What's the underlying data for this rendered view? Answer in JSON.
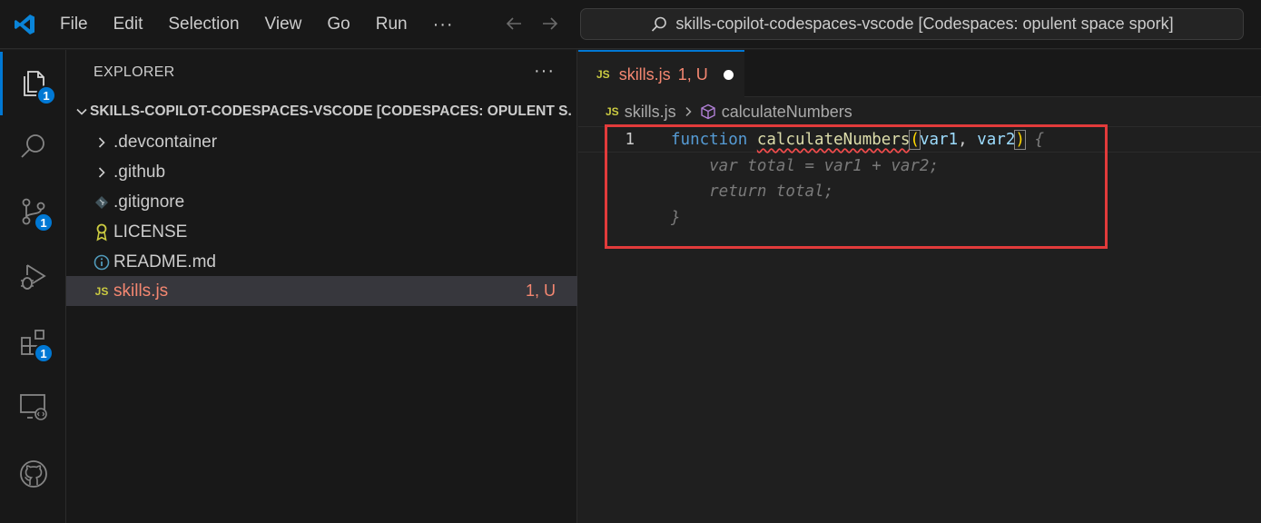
{
  "titlebar": {
    "menu": [
      "File",
      "Edit",
      "Selection",
      "View",
      "Go",
      "Run"
    ],
    "more": "···",
    "command_center": "skills-copilot-codespaces-vscode [Codespaces: opulent space spork]"
  },
  "activity_bar": {
    "items": [
      {
        "icon": "files-icon",
        "badge": "1",
        "active": true
      },
      {
        "icon": "search-icon",
        "badge": null
      },
      {
        "icon": "source-control-icon",
        "badge": "1"
      },
      {
        "icon": "run-debug-icon",
        "badge": null
      },
      {
        "icon": "extensions-icon",
        "badge": "1"
      },
      {
        "icon": "remote-explorer-icon",
        "badge": null
      },
      {
        "icon": "github-icon",
        "badge": null
      }
    ],
    "accent": "#0078d4"
  },
  "sidebar": {
    "title": "EXPLORER",
    "more": "···",
    "root": "SKILLS-COPILOT-CODESPACES-VSCODE [CODESPACES: OPULENT S...",
    "items": [
      {
        "label": ".devcontainer",
        "icon": "chevron-right-icon"
      },
      {
        "label": ".github",
        "icon": "chevron-right-icon"
      },
      {
        "label": ".gitignore",
        "icon": "git-icon"
      },
      {
        "label": "LICENSE",
        "icon": "license-icon"
      },
      {
        "label": "README.md",
        "icon": "info-icon"
      },
      {
        "label": "skills.js",
        "icon": "js-icon",
        "icon_text": "JS",
        "status": "1, U",
        "selected": true
      }
    ]
  },
  "editor": {
    "tab": {
      "icon_text": "JS",
      "label": "skills.js",
      "status": "1, U"
    },
    "breadcrumbs": {
      "file": "skills.js",
      "symbol": "calculateNumbers"
    },
    "code": {
      "line1": {
        "number": "1",
        "kw": "function",
        "fn": "calculateNumbers",
        "open_paren": "(",
        "p1": "var1",
        "comma": ",",
        "p2": "var2",
        "close_paren": ")",
        "brace": "{"
      },
      "suggestion": [
        "    var total = var1 + var2;",
        "    return total;",
        "}"
      ]
    },
    "colors": {
      "modified": "#f48771",
      "keyword": "#569cd6",
      "function": "#dcdcaa",
      "param": "#9cdcfe",
      "highlight_box": "#e23b3b"
    }
  }
}
